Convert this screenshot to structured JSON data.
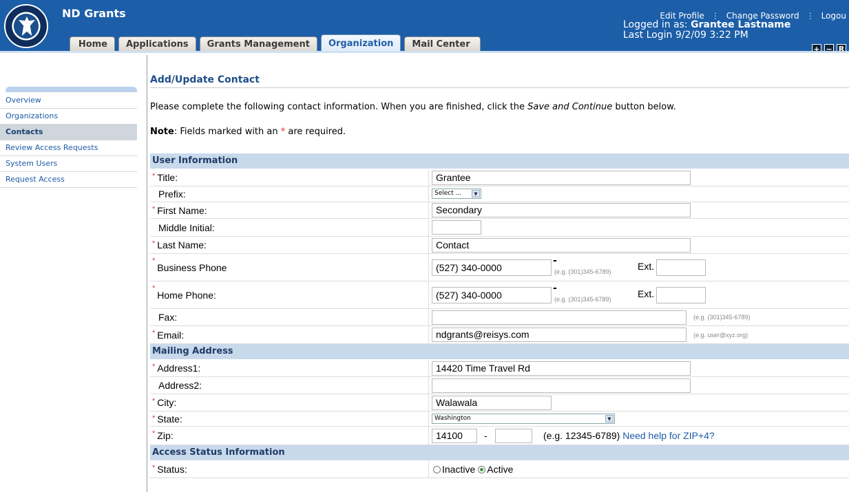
{
  "app": {
    "title": "ND Grants"
  },
  "tabs": [
    "Home",
    "Applications",
    "Grants Management",
    "Organization",
    "Mail Center"
  ],
  "header": {
    "edit_profile": "Edit Profile",
    "change_password": "Change Password",
    "logout": "Logou",
    "logged_in_prefix": "Logged in as:",
    "user_name": "Grantee Lastname",
    "last_login": "Last Login 9/2/09 3:22 PM",
    "size_buttons": [
      "+",
      "−",
      "R"
    ]
  },
  "sidebar": {
    "items": [
      "Overview",
      "Organizations",
      "Contacts",
      "Review Access Requests",
      "System Users",
      "Request Access"
    ],
    "active": "Contacts"
  },
  "main": {
    "title": "Add/Update Contact",
    "instruction_pre": "Please complete the following contact information. When you are finished, click the ",
    "instruction_em": "Save and Continue",
    "instruction_post": " button below.",
    "note_label": "Note",
    "note_pre": ": Fields marked with an ",
    "note_star": "*",
    "note_post": " are required."
  },
  "sections": {
    "user": "User Information",
    "mailing": "Mailing Address",
    "access": "Access Status Information"
  },
  "fields": {
    "title": {
      "label": "Title:",
      "value": "Grantee"
    },
    "prefix": {
      "label": "Prefix:",
      "value": "Select ..."
    },
    "first_name": {
      "label": "First Name:",
      "value": "Secondary"
    },
    "middle_initial": {
      "label": "Middle Initial:",
      "value": ""
    },
    "last_name": {
      "label": "Last Name:",
      "value": "Contact"
    },
    "business_phone": {
      "label": "Business Phone",
      "value": "(527) 340-0000",
      "hint": "(e.g. (301)345-6789)",
      "ext_label": "Ext.",
      "ext_value": ""
    },
    "home_phone": {
      "label": "Home Phone:",
      "value": "(527) 340-0000",
      "hint": "(e.g. (301)345-6789)",
      "ext_label": "Ext.",
      "ext_value": ""
    },
    "fax": {
      "label": "Fax:",
      "value": "",
      "hint": "(e.g. (301)345-6789)"
    },
    "email": {
      "label": "Email:",
      "value": "ndgrants@reisys.com",
      "hint": "(e.g. user@xyz.org)"
    },
    "address1": {
      "label": "Address1:",
      "value": "14420 Time Travel Rd"
    },
    "address2": {
      "label": "Address2:",
      "value": ""
    },
    "city": {
      "label": "City:",
      "value": "Walawala"
    },
    "state": {
      "label": "State:",
      "value": "Washington"
    },
    "zip": {
      "label": "Zip:",
      "value": "14100",
      "plus4": "",
      "dash": "-",
      "hint": "(e.g. 12345-6789)",
      "help_link": "Need help for ZIP+4?"
    },
    "status": {
      "label": "Status:",
      "options": [
        "Inactive",
        "Active"
      ],
      "selected": "Active"
    }
  },
  "req_mark": "*",
  "dash_char": "-",
  "dropdown_arrow": "chevron-down-icon"
}
